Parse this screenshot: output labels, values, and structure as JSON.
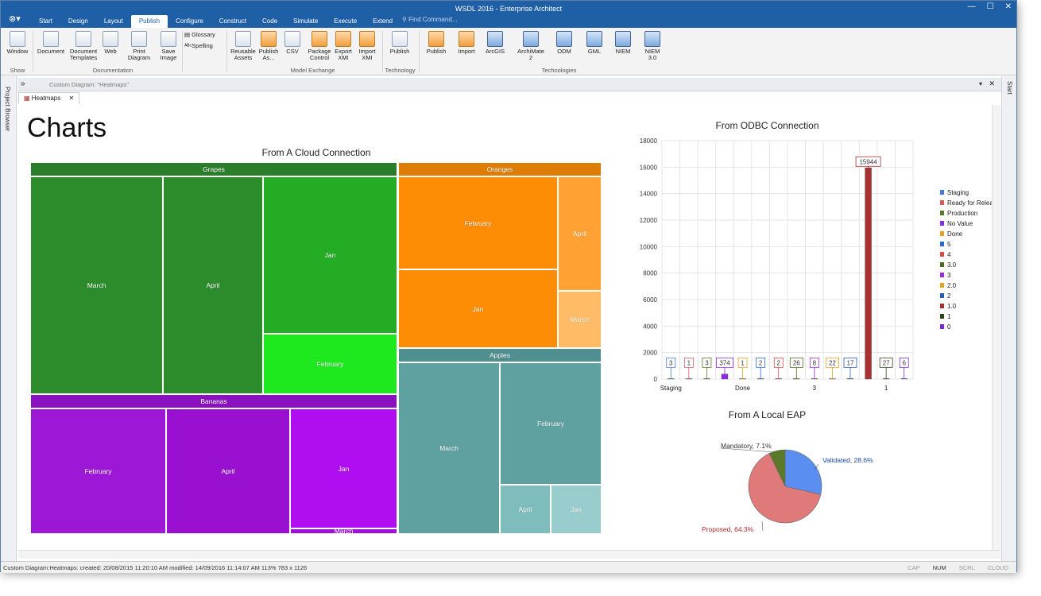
{
  "window": {
    "title": "WSDL 2016 - Enterprise Architect",
    "controls": [
      "—",
      "☐",
      "✕"
    ]
  },
  "menu": {
    "app_glyph": "⊗▾",
    "tabs": [
      "Start",
      "Design",
      "Layout",
      "Publish",
      "Configure",
      "Construct",
      "Code",
      "Simulate",
      "Execute",
      "Extend"
    ],
    "active_tab": "Publish",
    "find_command": "Find Command..."
  },
  "ribbon": {
    "buttons": [
      {
        "label": "Window",
        "icon": "window-icon"
      },
      {
        "label": "Document",
        "icon": "document-icon"
      },
      {
        "label": "Document Templates",
        "icon": "document-templates-icon"
      },
      {
        "label": "Web",
        "icon": "web-icon"
      },
      {
        "label": "Print Diagram",
        "icon": "print-icon"
      },
      {
        "label": "Save Image",
        "icon": "save-image-icon"
      },
      {
        "label": "Glossary",
        "icon": "glossary-icon"
      },
      {
        "label": "Spelling",
        "icon": "spelling-icon"
      },
      {
        "label": "Reusable Assets",
        "icon": "reusable-assets-icon"
      },
      {
        "label": "Publish As...",
        "icon": "publish-as-icon"
      },
      {
        "label": "CSV",
        "icon": "csv-icon"
      },
      {
        "label": "Package Control",
        "icon": "package-control-icon"
      },
      {
        "label": "Export XMI",
        "icon": "export-xmi-icon"
      },
      {
        "label": "Import XMI",
        "icon": "import-xmi-icon"
      },
      {
        "label": "Publish",
        "icon": "publish-technology-icon"
      },
      {
        "label": "Publish",
        "icon": "publish-icon"
      },
      {
        "label": "Import",
        "icon": "import-icon"
      },
      {
        "label": "ArcGIS",
        "icon": "arcgis-icon"
      },
      {
        "label": "ArchiMate 2",
        "icon": "archimate-icon"
      },
      {
        "label": "ODM",
        "icon": "odm-icon"
      },
      {
        "label": "GML",
        "icon": "gml-icon"
      },
      {
        "label": "NIEM",
        "icon": "niem-icon"
      },
      {
        "label": "NIEM 3.0",
        "icon": "niem3-icon"
      }
    ],
    "groups": [
      "Show",
      "Documentation",
      "Model Exchange",
      "Technology",
      "Technologies"
    ]
  },
  "side": {
    "left_panel": "Project Browser",
    "right_panel": "Start"
  },
  "doc": {
    "caption": "Custom Diagram: \"Heatmaps\"",
    "tab_label": "Heatmaps"
  },
  "canvas": {
    "page_title": "Charts"
  },
  "treemap": {
    "title": "From A Cloud Connection",
    "groups": [
      {
        "name": "Grapes",
        "header_color": "#2a7d2a",
        "cells": [
          {
            "label": "March",
            "value": 20,
            "color": "#2c8c2c"
          },
          {
            "label": "April",
            "value": 16,
            "color": "#2c8c2c"
          },
          {
            "label": "Jan",
            "value": 13,
            "color": "#24ac24"
          },
          {
            "label": "February",
            "value": 5,
            "color": "#1ee81e"
          }
        ]
      },
      {
        "name": "Bananas",
        "header_color": "#8a10c0",
        "cells": [
          {
            "label": "February",
            "value": 11,
            "color": "#9d18d6"
          },
          {
            "label": "April",
            "value": 10,
            "color": "#9a10d0"
          },
          {
            "label": "Jan",
            "value": 8,
            "color": "#b00ef0"
          },
          {
            "label": "March",
            "value": 0.2,
            "color": "#a010d8"
          }
        ]
      },
      {
        "name": "Oranges",
        "header_color": "#dd7d05",
        "cells": [
          {
            "label": "February",
            "value": 11,
            "color": "#ff8c05"
          },
          {
            "label": "Jan",
            "value": 10,
            "color": "#ff8c05"
          },
          {
            "label": "April",
            "value": 5,
            "color": "#ffa133"
          },
          {
            "label": "March",
            "value": 2.4,
            "color": "#ffbb66"
          }
        ]
      },
      {
        "name": "Apples",
        "header_color": "#4f8f8f",
        "cells": [
          {
            "label": "March",
            "value": 13,
            "color": "#5fa0a0"
          },
          {
            "label": "February",
            "value": 8,
            "color": "#5fa0a0"
          },
          {
            "label": "April",
            "value": 2.2,
            "color": "#7fbcbc"
          },
          {
            "label": "Jan",
            "value": 2.1,
            "color": "#99cccc"
          }
        ]
      }
    ]
  },
  "chart_data": [
    {
      "type": "bar",
      "title": "From ODBC Connection",
      "ylim": [
        0,
        18000
      ],
      "yticks": [
        0,
        2000,
        4000,
        6000,
        8000,
        10000,
        12000,
        14000,
        16000,
        18000
      ],
      "x_tick_labels": [
        "Staging",
        "Done",
        "3",
        "1"
      ],
      "grid": true,
      "legend_position": "right",
      "series": [
        {
          "name": "Staging",
          "value": 3,
          "color": "#4a78d8"
        },
        {
          "name": "Ready for Release",
          "value": 1,
          "color": "#d85a5a"
        },
        {
          "name": "Production",
          "value": 3,
          "color": "#5a7a2a"
        },
        {
          "name": "No Value",
          "value": 374,
          "color": "#8a2ce0"
        },
        {
          "name": "Done",
          "value": 1,
          "color": "#e8a020"
        },
        {
          "name": "5",
          "value": 2,
          "color": "#2a6ad0"
        },
        {
          "name": "4",
          "value": 2,
          "color": "#d84a4a"
        },
        {
          "name": "3.0",
          "value": 26,
          "color": "#4a6a20"
        },
        {
          "name": "3",
          "value": 8,
          "color": "#9a2ae0"
        },
        {
          "name": "2.0",
          "value": 22,
          "color": "#e8a020"
        },
        {
          "name": "2",
          "value": 17,
          "color": "#2a5ac0"
        },
        {
          "name": "1.0",
          "value": 15944,
          "color": "#a83030"
        },
        {
          "name": "1",
          "value": 27,
          "color": "#2a4a10"
        },
        {
          "name": "0",
          "value": 6,
          "color": "#7a2ad0"
        }
      ]
    },
    {
      "type": "pie",
      "title": "From A Local EAP",
      "slices": [
        {
          "label": "Validated, 28.6%",
          "value": 28.6,
          "color": "#5a8ef0",
          "label_color": "#1a4aa8"
        },
        {
          "label": "Proposed, 64.3%",
          "value": 64.3,
          "color": "#e07a7a",
          "label_color": "#b02a2a"
        },
        {
          "label": "Mandatory, 7.1%",
          "value": 7.1,
          "color": "#5a7a2a",
          "label_color": "#333333"
        }
      ]
    }
  ],
  "status": {
    "left": "Custom Diagram:Heatmaps:  created: 20/08/2015 11:20:10 AM  modified: 14/09/2016 11:14:07 AM   113%   783 x 1126",
    "indicators": [
      "CAP",
      "NUM",
      "SCRL",
      "CLOUD"
    ],
    "active_indicator": "NUM"
  }
}
